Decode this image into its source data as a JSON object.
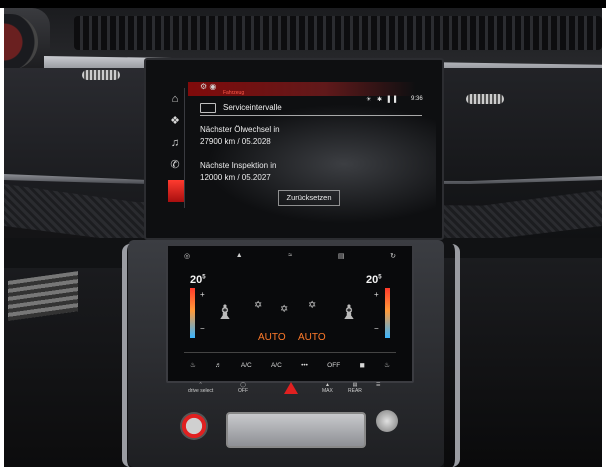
{
  "mmi": {
    "crumb": "Fahrzeug",
    "title": "Serviceintervalle",
    "status_icons": "☀ ✱ ▌▌",
    "time": "9:36",
    "oil_label": "Nächster Ölwechsel in",
    "oil_value": "27900 km / 05.2028",
    "inspection_label": "Nächste Inspektion in",
    "inspection_value": "12000 km / 05.2027",
    "reset_button": "Zurücksetzen",
    "rail_icons": [
      "home-icon",
      "car-settings-icon",
      "music-icon",
      "phone-icon"
    ],
    "accent_color": "#e3271c"
  },
  "climate": {
    "temp_left": "20",
    "temp_left_unit": "5",
    "temp_right": "20",
    "temp_right_unit": "5",
    "mode_left": "AUTO",
    "mode_right": "AUTO",
    "plus": "+",
    "minus": "−",
    "bottom": {
      "ac": "A/C",
      "ac_max": "A/C",
      "more": "•••",
      "off": "OFF"
    },
    "accent_color": "#ff7a2a"
  },
  "controls": {
    "drive_select_a": "drive",
    "drive_select_b": "select",
    "parking": "P",
    "off": "OFF",
    "max": "MAX",
    "rear": "REAR"
  }
}
